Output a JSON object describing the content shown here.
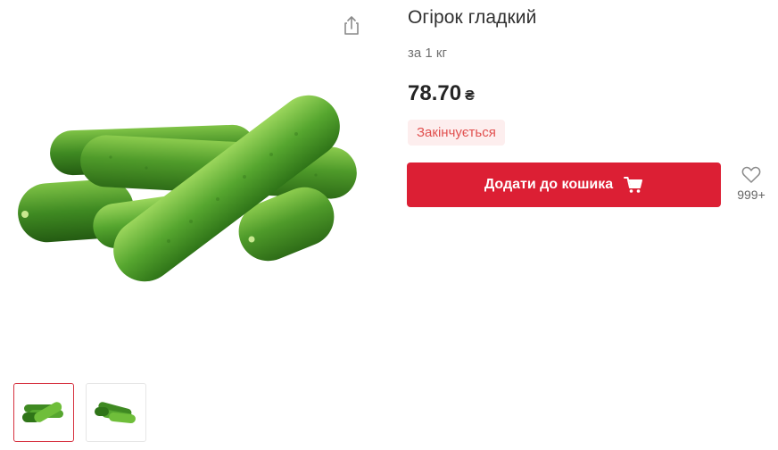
{
  "product": {
    "title": "Огірок гладкий",
    "unit": "за 1 кг",
    "price": "78.70",
    "currency": "₴",
    "stock_badge": "Закінчується"
  },
  "actions": {
    "add_to_cart_label": "Додати до кошика",
    "favorites_count": "999+"
  },
  "gallery": {
    "thumbnails_count": 2,
    "active_thumbnail": 0
  },
  "colors": {
    "accent": "#dc1f34",
    "badge_bg": "#fdeeee",
    "badge_text": "#e1504f",
    "thumb_active_border": "#d6313f"
  },
  "icons": {
    "share": "share-icon",
    "cart": "cart-icon",
    "favorite": "heart-icon"
  }
}
